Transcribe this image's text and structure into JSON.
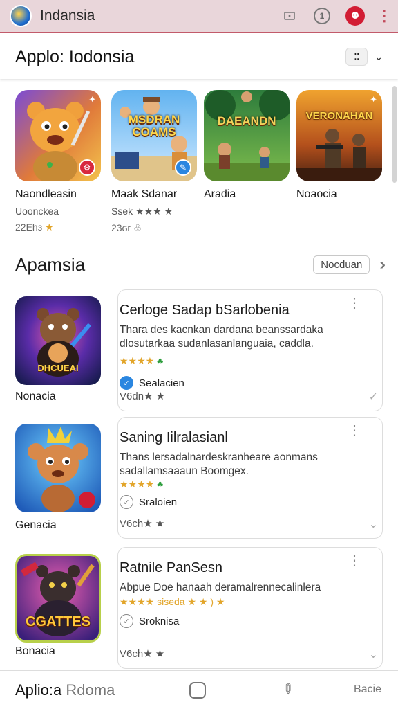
{
  "topbar": {
    "title": "Indansia",
    "icons": [
      "tv-icon",
      "clock-icon",
      "profile-icon",
      "more-vertical-icon"
    ]
  },
  "header": {
    "title": "Applo: Iodonsia"
  },
  "featured": [
    {
      "name": "Naondleasin",
      "subtitle": "Uoonckea",
      "size": "22Ehз",
      "stars": "★",
      "banner": "",
      "badge": "⚙"
    },
    {
      "name": "Maak Sdanar",
      "subtitle": "Ssek ★★★ ★",
      "size": "23ϭr",
      "stars": "♧",
      "banner": "MSDRAN COAMS",
      "badge": "✎"
    },
    {
      "name": "Aradia",
      "subtitle": "",
      "size": "",
      "stars": "",
      "banner": "DAEANDN",
      "badge": ""
    },
    {
      "name": "Noaocia",
      "subtitle": "",
      "size": "",
      "stars": "",
      "banner": "VERONAHAN",
      "badge": ""
    }
  ],
  "section": {
    "title": "Apamsia",
    "more_label": "Nocduan",
    "arrows": "»"
  },
  "list": [
    {
      "icon_label": "Nonacia",
      "icon_banner": "DHCUEAI",
      "title": "Cerloge Sadap bSarlobenia",
      "description": "Thara des kacnkan dardana beanssardaka dlosutarkaa sudanlasanlanguaia, caddla.",
      "rating": "★★★★",
      "rating_extra": "♣",
      "tag": "Sealacien",
      "meta": "V6dn★ ★",
      "tag_color": "#2a86e0"
    },
    {
      "icon_label": "Genacia",
      "icon_banner": "",
      "title": "Saning Iilralasianl",
      "description": "Thans lersadalnardeskranheare aonmans sadallamsaaaun Boomgex.",
      "rating": "★★★★",
      "rating_extra": "♣",
      "tag": "Sraloien",
      "meta": "V6ch★ ★",
      "tag_color": "#ffffff"
    },
    {
      "icon_label": "Bonacia",
      "icon_banner": "CGATTES",
      "title": "Ratnile PanSesn",
      "description": "Abpue Doe hanaah deramalrennecalinlera",
      "rating": "★★★★ siseda ★ ★ ) ★",
      "rating_extra": "",
      "tag": "Sroknisa",
      "meta": "V6ch★ ★",
      "tag_color": "#ffffff"
    }
  ],
  "bottombar": {
    "label_a": "Aplio:a",
    "label_b": "Rdoma",
    "right_label": "Bacie"
  }
}
